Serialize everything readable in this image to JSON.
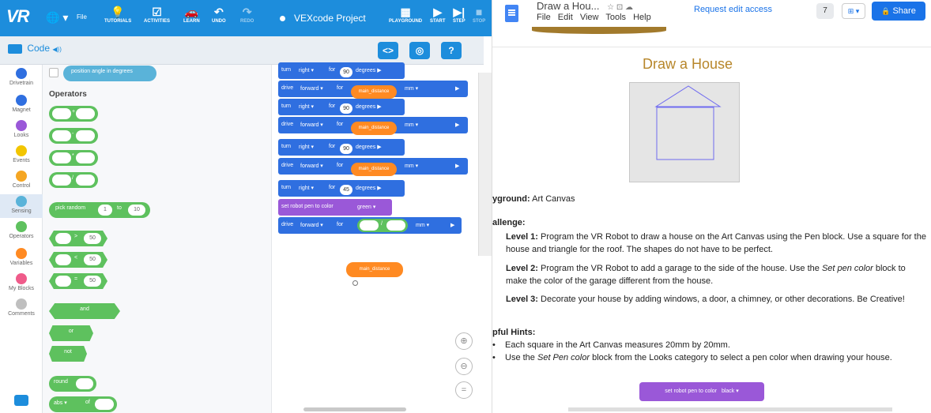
{
  "vex": {
    "logo": "VR",
    "globe_icon": "🌐 ▾",
    "file_menu": "File",
    "toolbar": [
      {
        "label": "TUTORIALS",
        "icon": "💡"
      },
      {
        "label": "ACTIVITIES",
        "icon": "☑"
      },
      {
        "label": "LEARN",
        "icon": "🚗"
      },
      {
        "label": "UNDO",
        "icon": "↶"
      },
      {
        "label": "REDO",
        "icon": "↷"
      }
    ],
    "project_name": "VEXcode Project",
    "right_toolbar": [
      {
        "label": "PLAYGROUND",
        "icon": "▦"
      },
      {
        "label": "START",
        "icon": "▶"
      },
      {
        "label": "STEP",
        "icon": "▶|"
      },
      {
        "label": "STOP",
        "icon": "■"
      }
    ],
    "code_tab": "Code",
    "code_tab_speaker": "◀))",
    "code_tools": {
      "code_view": "<>",
      "dashboard": "◎",
      "help": "?"
    },
    "categories": [
      {
        "label": "Drivetrain",
        "color": "#2f6fe0"
      },
      {
        "label": "Magnet",
        "color": "#2f6fe0"
      },
      {
        "label": "Looks",
        "color": "#9a58d8"
      },
      {
        "label": "Events",
        "color": "#f2c500"
      },
      {
        "label": "Control",
        "color": "#f5a623"
      },
      {
        "label": "Sensing",
        "color": "#5ab3d9"
      },
      {
        "label": "Operators",
        "color": "#5ec15e"
      },
      {
        "label": "Variables",
        "color": "#ff8a22"
      },
      {
        "label": "My Blocks",
        "color": "#ef5b8a"
      },
      {
        "label": "Comments",
        "color": "#bfbfbf"
      }
    ],
    "flyout": {
      "top_reporter": "position angle in degrees",
      "heading": "Operators",
      "arith_ops": [
        "+",
        "-",
        "*",
        "/"
      ],
      "pick_random": {
        "label": "pick random",
        "from": "1",
        "to_label": "to",
        "to": "10"
      },
      "compare": [
        {
          "op": ">",
          "value": "50"
        },
        {
          "op": "<",
          "value": "50"
        },
        {
          "op": "=",
          "value": "50"
        }
      ],
      "logic": [
        "and",
        "or",
        "not"
      ],
      "round": "round",
      "abs": "abs ▾",
      "abs_of": "of"
    },
    "script": [
      {
        "kind": "turn",
        "verb": "turn",
        "dir": "right ▾",
        "for": "for",
        "value": "90",
        "unit": "degrees ▶"
      },
      {
        "kind": "drive",
        "verb": "drive",
        "dir": "forward ▾",
        "for": "for",
        "var": "main_distance",
        "unit": "mm ▾",
        "arrow": "▶"
      },
      {
        "kind": "turn",
        "verb": "turn",
        "dir": "right ▾",
        "for": "for",
        "value": "90",
        "unit": "degrees ▶"
      },
      {
        "kind": "drive",
        "verb": "drive",
        "dir": "forward ▾",
        "for": "for",
        "var": "main_distance",
        "unit": "mm ▾",
        "arrow": "▶"
      },
      {
        "kind": "turn",
        "verb": "turn",
        "dir": "right ▾",
        "for": "for",
        "value": "90",
        "unit": "degrees ▶"
      },
      {
        "kind": "drive",
        "verb": "drive",
        "dir": "forward ▾",
        "for": "for",
        "var": "main_distance",
        "unit": "mm ▾",
        "arrow": "▶"
      },
      {
        "kind": "turn",
        "verb": "turn",
        "dir": "right ▾",
        "for": "for",
        "value": "45",
        "unit": "degrees ▶"
      },
      {
        "kind": "pen",
        "label": "set robot pen to color",
        "color": "green ▾"
      },
      {
        "kind": "drive_div",
        "verb": "drive",
        "dir": "forward ▾",
        "for": "for",
        "op": "/",
        "unit": "mm ▾",
        "arrow": "▶"
      }
    ],
    "loose_reporter": "main_distance",
    "zoom": [
      "⊕",
      "⊖",
      "="
    ]
  },
  "doc": {
    "title": "Draw a Hou...",
    "title_icons": "☆ ⊡ ☁",
    "menu": [
      "File",
      "Edit",
      "View",
      "Tools",
      "Help"
    ],
    "request_access": "Request edit access",
    "comments_count": "7",
    "present_icon": "⊞ ▾",
    "share": "Share",
    "share_icon": "🔒",
    "heading": "Draw a House",
    "playground_label": "yground:",
    "playground_value": "Art Canvas",
    "challenge_label": "allenge:",
    "levels": [
      {
        "label": "Level 1:",
        "text": "Program the VR Robot to draw a house on the Art Canvas using the Pen block. Use a square for the house and triangle for the roof. The shapes do not have to be perfect."
      },
      {
        "label": "Level 2:",
        "text_a": "Program the VR Robot to add a garage to the side of the house. Use the",
        "em": "Set pen color",
        "text_b": "block to make the color of the garage different from the house."
      },
      {
        "label": "Level 3:",
        "text": "Decorate your house by adding windows, a door, a chimney, or other decorations. Be Creative!"
      }
    ],
    "hints_label": "pful Hints:",
    "hints": [
      {
        "text": "Each square in the Art Canvas measures 20mm by 20mm."
      },
      {
        "text_a": "Use the",
        "em": "Set Pen color",
        "text_b": "block from the Looks category to select a pen color when drawing your house."
      }
    ],
    "bullet": "•",
    "block": {
      "label": "set robot pen to color",
      "color": "black ▾"
    }
  }
}
